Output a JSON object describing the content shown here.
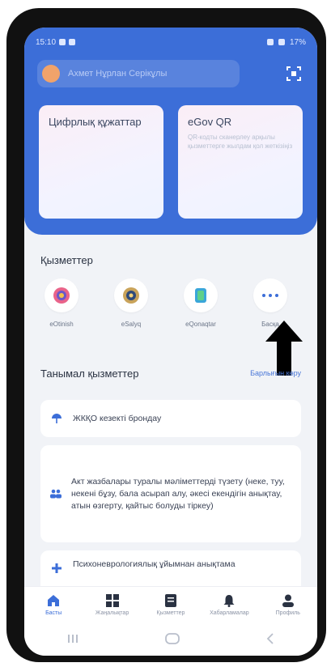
{
  "status_bar": {
    "time": "15:10",
    "battery": "17%"
  },
  "header": {
    "user_name": "Ахмет Нұрлан Серікұлы"
  },
  "cards": [
    {
      "title": "Цифрлық құжаттар",
      "subtitle": ""
    },
    {
      "title": "eGov QR",
      "subtitle": "QR-кодты сканерлеу арқылы қызметтерге жылдам қол жеткізіңіз"
    }
  ],
  "services": {
    "title": "Қызметтер",
    "items": [
      {
        "name": "eOtinish"
      },
      {
        "name": "eSalyq"
      },
      {
        "name": "eQonaqtar"
      },
      {
        "name": "Басқа"
      }
    ]
  },
  "popular": {
    "title": "Танымал қызметтер",
    "view_all": "Барлығын көру",
    "items": [
      {
        "text": "ЖКҚО кезекті брондау"
      },
      {
        "text": "Акт жазбалары туралы мәліметтерді түзету (неке, туу, некені бұзу, бала асырап алу, әкесі екендігін анықтау, атын өзгерту, қайтыс болуды тіркеу)"
      },
      {
        "text": "Психоневрологиялық ұйымнан анықтама"
      }
    ]
  },
  "nav": [
    {
      "label": "Басты"
    },
    {
      "label": "Жаңалықтар"
    },
    {
      "label": "Қызметтер"
    },
    {
      "label": "Хабарламалар"
    },
    {
      "label": "Профиль"
    }
  ],
  "colors": {
    "primary": "#3c6ed8",
    "background": "#f1f3f7"
  }
}
